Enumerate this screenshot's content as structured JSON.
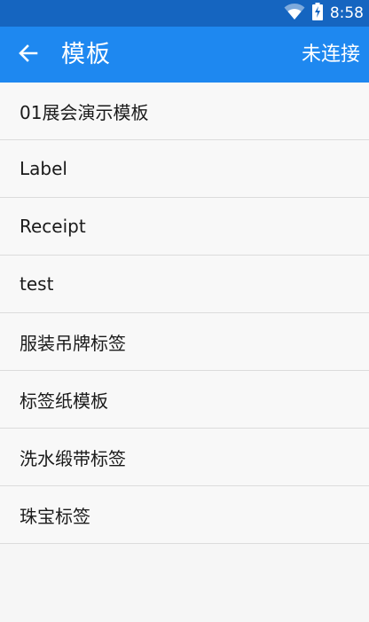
{
  "status_bar": {
    "time": "8:58",
    "icons": [
      "wifi-icon",
      "battery-charging-icon"
    ]
  },
  "app_bar": {
    "back_icon": "arrow-left-icon",
    "title": "模板",
    "connection_status": "未连接"
  },
  "templates": [
    {
      "label": "01展会演示模板"
    },
    {
      "label": "Label"
    },
    {
      "label": "Receipt"
    },
    {
      "label": "test"
    },
    {
      "label": "服装吊牌标签"
    },
    {
      "label": "标签纸模板"
    },
    {
      "label": "洗水缎带标签"
    },
    {
      "label": "珠宝标签"
    }
  ],
  "colors": {
    "status_bar": "#1565c0",
    "app_bar": "#1e88f0",
    "background": "#f6f6f6",
    "divider": "#dcdcdc"
  }
}
